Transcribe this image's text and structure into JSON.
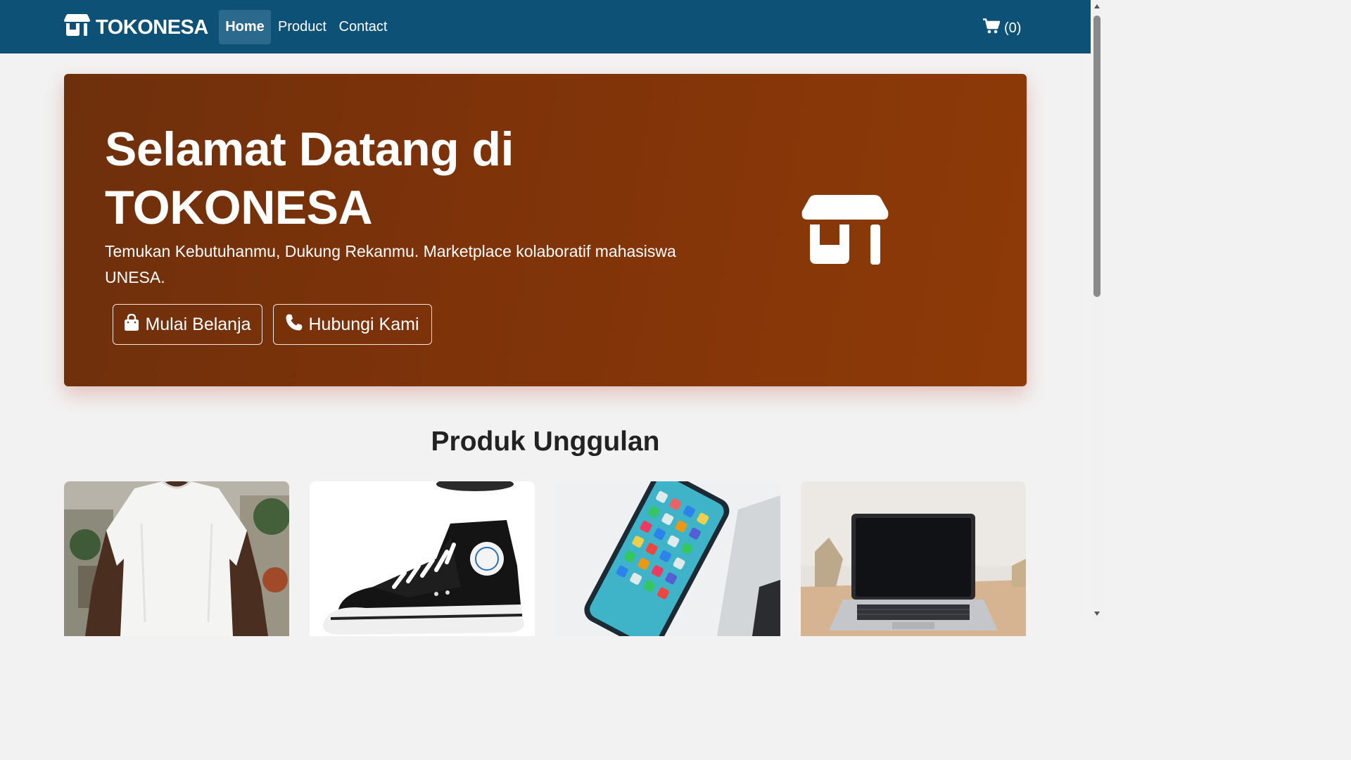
{
  "nav": {
    "brand": "TOKONESA",
    "links": [
      "Home",
      "Product",
      "Contact"
    ],
    "cart_count": "(0)"
  },
  "hero": {
    "title": "Selamat Datang di TOKONESA",
    "subtitle": "Temukan Kebutuhanmu, Dukung Rekanmu. Marketplace kolaboratif mahasiswa UNESA.",
    "buttons": [
      "Mulai Belanja",
      "Hubungi Kami"
    ]
  },
  "featured": {
    "title": "Produk Unggulan",
    "products": [
      {
        "image": "white-tshirt-photo"
      },
      {
        "image": "black-sneaker-photo"
      },
      {
        "image": "smartphone-photo"
      },
      {
        "image": "laptop-photo"
      }
    ]
  },
  "colors": {
    "navbar": "#0d5276",
    "hero_start": "#6e300c",
    "hero_end": "#8e3a08",
    "background": "#f2f2f2"
  }
}
